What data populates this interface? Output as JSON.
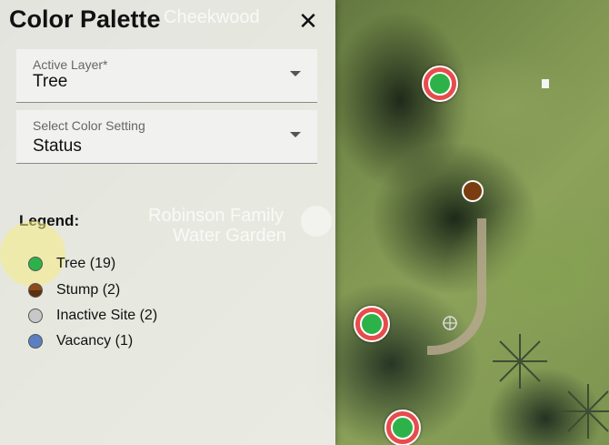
{
  "panel": {
    "title": "Color Palette",
    "close_label": "✕",
    "active_layer": {
      "label": "Active Layer*",
      "value": "Tree"
    },
    "color_setting": {
      "label": "Select Color Setting",
      "value": "Status"
    },
    "legend_title": "Legend:",
    "legend": [
      {
        "label": "Tree (19)",
        "color": "#2db24a"
      },
      {
        "label": "Stump (2)",
        "color": "#8b4a1a"
      },
      {
        "label": "Inactive Site (2)",
        "color": "#c8c8c8"
      },
      {
        "label": "Vacancy (1)",
        "color": "#5b7fc0"
      }
    ]
  },
  "map": {
    "labels": {
      "cheekwood": "Cheekwood",
      "robinson": "Robinson Family",
      "water_garden": "Water Garden"
    }
  }
}
